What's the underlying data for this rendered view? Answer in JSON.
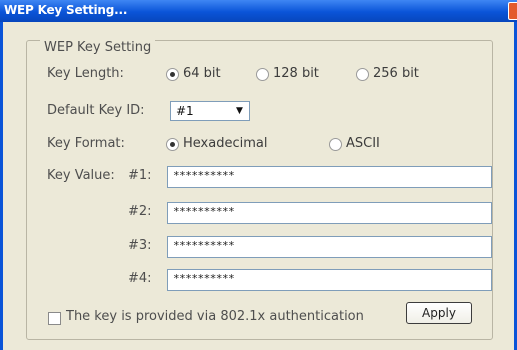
{
  "window": {
    "title": "WEP Key Setting..."
  },
  "group": {
    "title": "WEP Key Setting"
  },
  "key_length": {
    "label": "Key Length:",
    "options": [
      {
        "label": "64 bit",
        "selected": true
      },
      {
        "label": "128 bit",
        "selected": false
      },
      {
        "label": "256 bit",
        "selected": false
      }
    ]
  },
  "default_key_id": {
    "label": "Default Key ID:",
    "value": "#1"
  },
  "key_format": {
    "label": "Key Format:",
    "options": [
      {
        "label": "Hexadecimal",
        "selected": true
      },
      {
        "label": "ASCII",
        "selected": false
      }
    ]
  },
  "key_value": {
    "label": "Key Value:",
    "keys": [
      {
        "label": "#1:",
        "value": "**********"
      },
      {
        "label": "#2:",
        "value": "**********"
      },
      {
        "label": "#3:",
        "value": "**********"
      },
      {
        "label": "#4:",
        "value": "**********"
      }
    ]
  },
  "auth_checkbox": {
    "label": "The key is provided via 802.1x authentication",
    "checked": false
  },
  "apply_button": {
    "label": "Apply"
  },
  "colors": {
    "titlebar": "#0a54d8",
    "dialog_bg": "#ece9d8"
  }
}
